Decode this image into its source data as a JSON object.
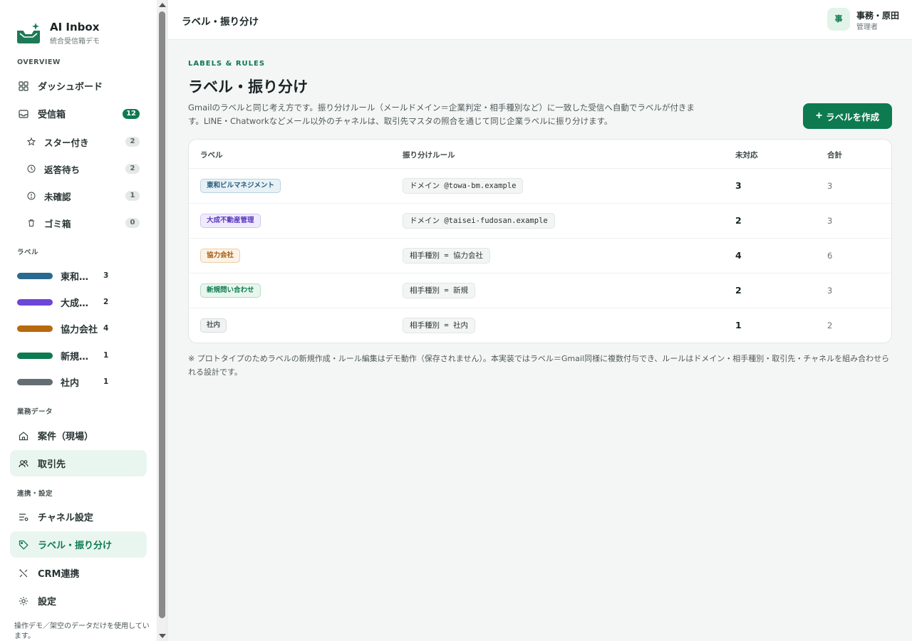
{
  "brand": {
    "title": "AI Inbox",
    "subtitle": "統合受信箱デモ"
  },
  "sidebar": {
    "overview_head": "OVERVIEW",
    "dashboard": "ダッシュボード",
    "inbox": {
      "label": "受信箱",
      "count": "12"
    },
    "sub_items": [
      {
        "label": "スター付き",
        "count": "2",
        "icon": "star-icon"
      },
      {
        "label": "返答待ち",
        "count": "2",
        "icon": "clock-icon"
      },
      {
        "label": "未確認",
        "count": "1",
        "icon": "alert-icon"
      },
      {
        "label": "ゴミ箱",
        "count": "0",
        "icon": "trash-icon"
      }
    ],
    "labels_head": "ラベル",
    "labels": [
      {
        "name": "東和ビルマネジメント",
        "count": "3",
        "color": "#2a6a8f"
      },
      {
        "name": "大成不動産管理",
        "count": "2",
        "color": "#6d46d8"
      },
      {
        "name": "協力会社",
        "count": "4",
        "color": "#b8690f"
      },
      {
        "name": "新規問い合わせ",
        "count": "1",
        "color": "#0d7a50"
      },
      {
        "name": "社内",
        "count": "1",
        "color": "#636e72"
      }
    ],
    "business_head": "業務データ",
    "projects": "案件（現場）",
    "clients": "取引先",
    "settings_head": "連携・設定",
    "channels": "チャネル設定",
    "labels_rules": "ラベル・振り分け",
    "crm": "CRM連携",
    "settings": "設定",
    "footer": "操作デモ／架空のデータだけを使用しています。"
  },
  "topbar": {
    "title": "ラベル・振り分け",
    "avatar": "事",
    "user_name": "事務・原田",
    "user_role": "管理者"
  },
  "main": {
    "eyebrow": "LABELS & RULES",
    "title": "ラベル・振り分け",
    "description": "Gmailのラベルと同じ考え方です。振り分けルール（メールドメイン＝企業判定・相手種別など）に一致した受信へ自動でラベルが付きます。LINE・Chatworkなどメール以外のチャネルは、取引先マスタの照合を通じて同じ企業ラベルに振り分けます。",
    "create_button": "ラベルを作成",
    "table": {
      "headers": [
        "ラベル",
        "振り分けルール",
        "未対応",
        "合計"
      ],
      "rows": [
        {
          "label": "東和ビルマネジメント",
          "rule": "ドメイン @towa-bm.example",
          "pending": "3",
          "total": "3",
          "fg": "#245b7c",
          "bg": "#e8f1f6",
          "border": "#b9d3e2"
        },
        {
          "label": "大成不動産管理",
          "rule": "ドメイン @taisei-fudosan.example",
          "pending": "2",
          "total": "3",
          "fg": "#5a37c0",
          "bg": "#f0ebfc",
          "border": "#d2c4f3"
        },
        {
          "label": "協力会社",
          "rule": "相手種別 = 協力会社",
          "pending": "4",
          "total": "6",
          "fg": "#a35a0b",
          "bg": "#fcf2e6",
          "border": "#edcfa8"
        },
        {
          "label": "新規問い合わせ",
          "rule": "相手種別 = 新規",
          "pending": "2",
          "total": "3",
          "fg": "#0d7a50",
          "bg": "#e8f6ee",
          "border": "#b3dcc6"
        },
        {
          "label": "社内",
          "rule": "相手種別 = 社内",
          "pending": "1",
          "total": "2",
          "fg": "#4e5858",
          "bg": "#f1f3f3",
          "border": "#d5dbda"
        }
      ]
    },
    "footnote": "※ プロトタイプのためラベルの新規作成・ルール編集はデモ動作（保存されません）。本実装ではラベル＝Gmail同様に複数付与でき、ルールはドメイン・相手種別・取引先・チャネルを組み合わせられる設計です。"
  }
}
